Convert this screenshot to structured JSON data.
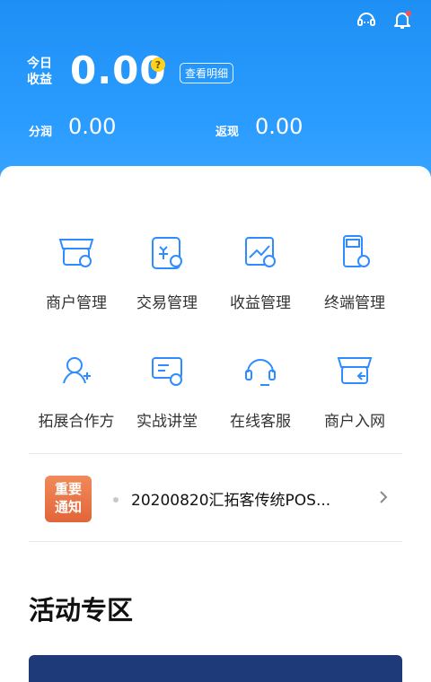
{
  "header": {
    "today_label_line1": "今日",
    "today_label_line2": "收益",
    "today_value": "0.00",
    "help_icon": "help-icon",
    "detail_button": "查看明细",
    "fenrun_label": "分润",
    "fenrun_value": "0.00",
    "fanxian_label": "返现",
    "fanxian_value": "0.00",
    "icons": [
      "headset-icon",
      "bell-icon"
    ],
    "colors": {
      "primary": "#1e90f5",
      "notify_dot": "#ff4d4f",
      "help_badge": "#ffd21f"
    }
  },
  "menu": {
    "items": [
      {
        "label": "商户管理",
        "icon": "merchant-manage-icon"
      },
      {
        "label": "交易管理",
        "icon": "transaction-manage-icon"
      },
      {
        "label": "收益管理",
        "icon": "earnings-manage-icon"
      },
      {
        "label": "终端管理",
        "icon": "terminal-manage-icon"
      },
      {
        "label": "拓展合作方",
        "icon": "partner-expand-icon"
      },
      {
        "label": "实战讲堂",
        "icon": "classroom-icon"
      },
      {
        "label": "在线客服",
        "icon": "customer-service-icon"
      },
      {
        "label": "商户入网",
        "icon": "merchant-join-icon"
      }
    ]
  },
  "notice": {
    "badge_line1": "重要",
    "badge_line2": "通知",
    "text": "20200820汇拓客传统POS...",
    "icon": "chevron-right-icon"
  },
  "activity": {
    "title": "活动专区"
  }
}
